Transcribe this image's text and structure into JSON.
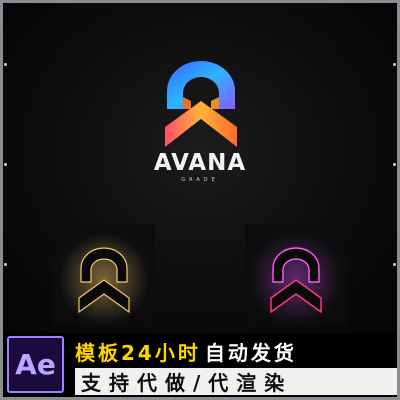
{
  "brand": {
    "title": "AVANA",
    "subtitle": "GRADE"
  },
  "banner": {
    "app_badge": "Ae",
    "line1_yellow": "模板24小时",
    "line1_white": "自动发货",
    "line2": "支持代做/代渲染"
  },
  "colors": {
    "frame": "#8a8e94",
    "yellow_text": "#ffd400",
    "badge_bg": "#1b0a3e",
    "badge_text": "#b9a7ff",
    "warm_glow": "#f0c060",
    "pink_glow": "#e040ff"
  },
  "icons": {
    "logo": "arch-chevron-logo",
    "preview_warm": "warm-glow-logo-preview",
    "preview_pink": "pink-glow-logo-preview"
  }
}
